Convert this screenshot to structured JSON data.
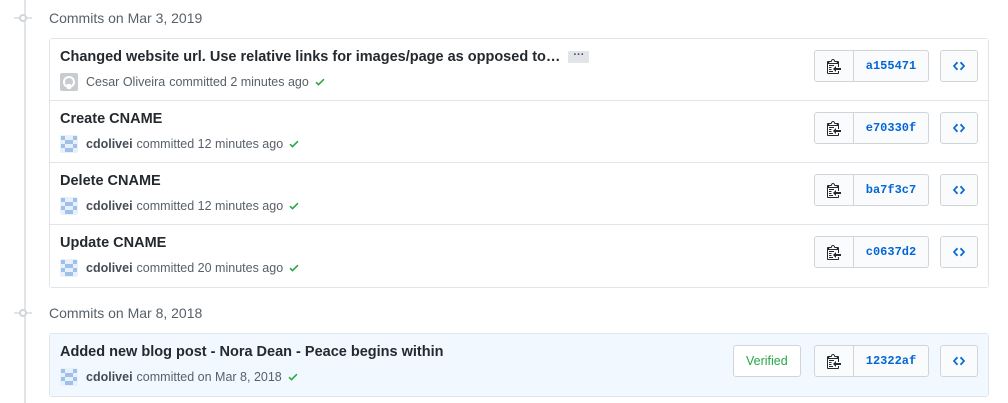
{
  "groups": [
    {
      "title": "Commits on Mar 3, 2019",
      "commits": [
        {
          "message": "Changed website url. Use relative links for images/page as opposed to…",
          "ellipsis": "···",
          "author": "Cesar Oliveira",
          "action": "committed 2 minutes ago",
          "sha": "a155471"
        },
        {
          "message": "Create CNAME",
          "author": "cdolivei",
          "action": "committed 12 minutes ago",
          "sha": "e70330f"
        },
        {
          "message": "Delete CNAME",
          "author": "cdolivei",
          "action": "committed 12 minutes ago",
          "sha": "ba7f3c7"
        },
        {
          "message": "Update CNAME",
          "author": "cdolivei",
          "action": "committed 20 minutes ago",
          "sha": "c0637d2"
        }
      ]
    },
    {
      "title": "Commits on Mar 8, 2018",
      "commits": [
        {
          "message": "Added new blog post - Nora Dean - Peace begins within",
          "author": "cdolivei",
          "action": "committed on Mar 8, 2018",
          "sha": "12322af",
          "badge": "Verified"
        }
      ]
    }
  ],
  "icons": {
    "copy": "clipboard-icon",
    "browse": "code-icon",
    "status": "check-icon",
    "node": "commit-node-icon"
  },
  "colors": {
    "link": "#0366d6",
    "success": "#28a745",
    "highlight_row": "#f1f8ff"
  }
}
